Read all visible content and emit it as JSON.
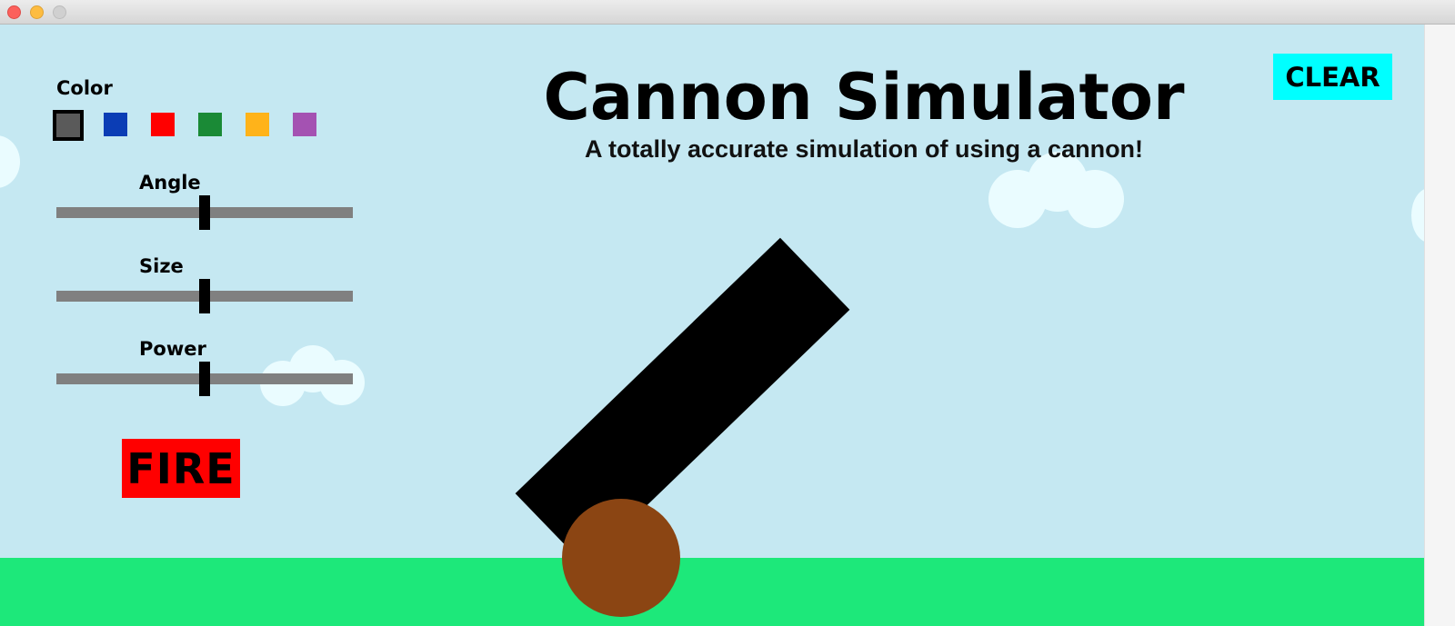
{
  "window": {
    "controls": [
      "close",
      "minimize",
      "maximize"
    ]
  },
  "header": {
    "title": "Cannon Simulator",
    "subtitle": "A totally accurate simulation of using a cannon!"
  },
  "controls": {
    "color_label": "Color",
    "colors": [
      "#5a5a5a",
      "#0b3db5",
      "#ff0000",
      "#1a8a36",
      "#ffb31a",
      "#a452b2"
    ],
    "selected_color_index": 0,
    "sliders": [
      {
        "label": "Angle",
        "value_fraction": 0.5
      },
      {
        "label": "Size",
        "value_fraction": 0.5
      },
      {
        "label": "Power",
        "value_fraction": 0.5
      }
    ],
    "fire_label": "FIRE",
    "clear_label": "CLEAR"
  },
  "colors": {
    "sky": "#c5e8f2",
    "ground": "#1de87a",
    "cloud": "#eafcff",
    "fire_button": "#ff0000",
    "clear_button": "#00ffff",
    "cannon_barrel": "#000000",
    "cannon_wheel": "#8b4513",
    "slider_track": "#808080"
  }
}
